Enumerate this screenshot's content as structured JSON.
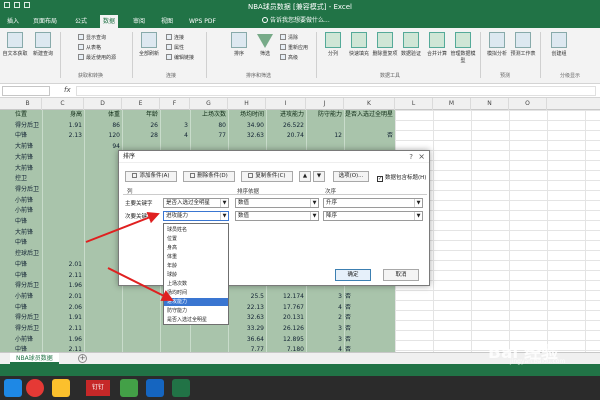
{
  "window": {
    "title": "NBA球员数据 [兼容模式] - Excel"
  },
  "ribbon_tabs": [
    "插入",
    "页面布局",
    "公式",
    "数据",
    "审阅",
    "视图",
    "WPS PDF"
  ],
  "active_tab": "数据",
  "tell_me": "告诉我您想要做什么...",
  "ribbon": {
    "buttons": [
      {
        "label": "自文本获取"
      },
      {
        "label": "新建查询"
      },
      {
        "label": "全部刷新"
      },
      {
        "label": "排序"
      },
      {
        "label": "筛选"
      },
      {
        "label": "分列"
      },
      {
        "label": "快速填充"
      },
      {
        "label": "删除重复项"
      },
      {
        "label": "数据验证"
      },
      {
        "label": "合并计算"
      },
      {
        "label": "管理数据模型"
      },
      {
        "label": "模拟分析"
      },
      {
        "label": "预测工作表"
      },
      {
        "label": "创建组"
      }
    ],
    "small": [
      {
        "label": "显示查询"
      },
      {
        "label": "从表格"
      },
      {
        "label": "最近使用的源"
      },
      {
        "label": "连接"
      },
      {
        "label": "属性"
      },
      {
        "label": "编辑链接"
      },
      {
        "label": "清除"
      },
      {
        "label": "重新应用"
      },
      {
        "label": "高级"
      }
    ],
    "groups": [
      "获取和转换",
      "连接",
      "排序和筛选",
      "数据工具",
      "预测",
      "分级显示"
    ]
  },
  "columns": [
    "B",
    "C",
    "D",
    "E",
    "F",
    "G",
    "H",
    "I",
    "J",
    "K",
    "L",
    "M",
    "N",
    "O"
  ],
  "table": {
    "headers": [
      "位置",
      "身高",
      "体重",
      "年龄",
      "",
      "上场次数",
      "场均时间",
      "进攻能力",
      "防守能力",
      "是否入选过全明星"
    ],
    "rows": [
      [
        "得分后卫",
        "1.91",
        "86",
        "26",
        "3",
        "80",
        "34.90",
        "26.522",
        "",
        ""
      ],
      [
        "中锋",
        "2.13",
        "120",
        "28",
        "4",
        "77",
        "32.63",
        "20.74",
        "12",
        "否"
      ],
      [
        "大前锋",
        "",
        "94",
        "",
        "",
        "",
        "",
        "",
        "",
        ""
      ],
      [
        "大前锋",
        "",
        "",
        "",
        "",
        "",
        "",
        "",
        "",
        ""
      ],
      [
        "大前锋",
        "",
        "",
        "",
        "",
        "",
        "",
        "",
        "",
        ""
      ],
      [
        "控卫",
        "",
        "",
        "",
        "",
        "",
        "",
        "",
        "",
        ""
      ],
      [
        "得分后卫",
        "",
        "",
        "",
        "",
        "",
        "",
        "",
        "",
        ""
      ],
      [
        "小前锋",
        "",
        "",
        "",
        "",
        "",
        "",
        "",
        "",
        ""
      ],
      [
        "小前锋",
        "",
        "",
        "",
        "",
        "",
        "",
        "",
        "",
        ""
      ],
      [
        "中锋",
        "",
        "",
        "",
        "",
        "",
        "",
        "",
        "",
        ""
      ],
      [
        "大前锋",
        "",
        "",
        "",
        "",
        "",
        "",
        "",
        "",
        ""
      ],
      [
        "中锋",
        "",
        "",
        "",
        "",
        "",
        "",
        "",
        "",
        ""
      ],
      [
        "控球后卫",
        "",
        "",
        "",
        "",
        "",
        "",
        "",
        "",
        ""
      ],
      [
        "中锋",
        "2.01",
        "",
        "",
        "",
        "",
        "",
        "",
        "",
        ""
      ],
      [
        "中锋",
        "2.11",
        "",
        "",
        "",
        "",
        "",
        "",
        "",
        ""
      ],
      [
        "得分后卫",
        "1.96",
        "",
        "",
        "",
        "",
        "",
        "",
        "",
        ""
      ],
      [
        "小前锋",
        "2.01",
        "",
        "",
        "",
        "",
        "",
        "",
        "",
        ""
      ],
      [
        "中锋",
        "2.06",
        "",
        "",
        "",
        "",
        "",
        "",
        "",
        ""
      ],
      [
        "得分后卫",
        "1.91",
        "",
        "",
        "",
        "",
        "",
        "",
        "",
        ""
      ],
      [
        "得分后卫",
        "2.11",
        "",
        "",
        "",
        "",
        "",
        "",
        "",
        ""
      ],
      [
        "小前锋",
        "1.96",
        "",
        "",
        "",
        "",
        "",
        "",
        "",
        ""
      ],
      [
        "中锋",
        "2.11",
        "",
        "",
        "",
        "",
        "",
        "",
        "",
        ""
      ]
    ],
    "right_values": [
      [
        "25.5",
        "12.174",
        "3",
        "否"
      ],
      [
        "22.13",
        "17.767",
        "4",
        "否"
      ],
      [
        "32.63",
        "20.131",
        "2",
        "否"
      ],
      [
        "33.29",
        "26.126",
        "3",
        "否"
      ],
      [
        "36.64",
        "12.895",
        "3",
        "否"
      ],
      [
        "7.77",
        "7.180",
        "4",
        "否"
      ]
    ]
  },
  "sheet_tab": "NBA球员数据",
  "dialog": {
    "title": "排序",
    "help": "?",
    "close": "×",
    "add_level": "添加条件(A)",
    "delete_level": "删除条件(D)",
    "copy_level": "复制条件(C)",
    "options": "选项(O)...",
    "has_header_label": "数据包含标题(H)",
    "col_header": "列",
    "sort_on_header": "排序依据",
    "order_header": "次序",
    "main_key_label": "主要关键字",
    "main_key_value": "是否入选过全明星",
    "main_sort_on": "数值",
    "main_order": "升序",
    "second_key_label": "次要关键字",
    "second_key_value": "进攻能力",
    "second_sort_on": "数值",
    "second_order": "降序",
    "dropdown_items": [
      "球员姓名",
      "位置",
      "身高",
      "体重",
      "年龄",
      "球龄",
      "上场次数",
      "场均时间",
      "进攻能力",
      "防守能力",
      "是否入选过全明星"
    ],
    "dropdown_selected": "进攻能力",
    "ok": "确定",
    "cancel": "取消"
  },
  "taskbar": {
    "app_label": "钉钉"
  },
  "watermark": {
    "main": "Bai 经验",
    "sub": "jingyan.baidu.com"
  },
  "colors": {
    "excel_green": "#217346",
    "selection": "#a9c4ab",
    "dropdown_highlight": "#3a76d1",
    "arrow": "#e02020"
  }
}
